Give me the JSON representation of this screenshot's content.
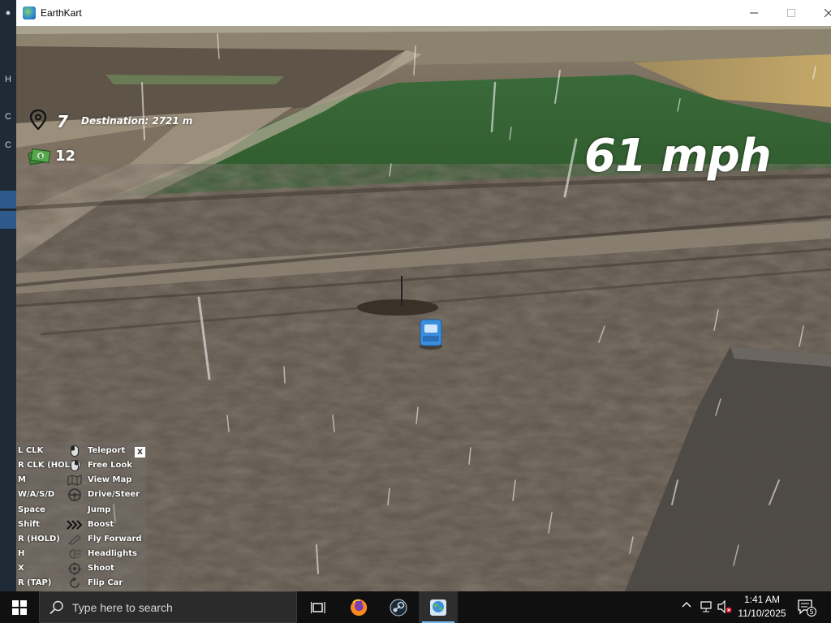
{
  "window": {
    "title": "EarthKart",
    "minimize": "—",
    "maximize": "☐",
    "close": "✕"
  },
  "hud": {
    "pin_count": "7",
    "destination": "Destination: 2721 m",
    "cash_count": "12",
    "speed": "61 mph"
  },
  "controls": {
    "close_label": "X",
    "rows": [
      {
        "key": "L CLK",
        "icon": "mouse-left-icon",
        "action": "Teleport"
      },
      {
        "key": "R CLK (HOLD)",
        "icon": "mouse-right-icon",
        "action": "Free Look"
      },
      {
        "key": "M",
        "icon": "map-icon",
        "action": "View Map"
      },
      {
        "key": "W/A/S/D",
        "icon": "steering-wheel-icon",
        "action": "Drive/Steer"
      },
      {
        "key": "Space",
        "icon": "jump-icon",
        "action": "Jump"
      },
      {
        "key": "Shift",
        "icon": "boost-icon",
        "action": "Boost"
      },
      {
        "key": "R (HOLD)",
        "icon": "fly-icon",
        "action": "Fly Forward"
      },
      {
        "key": "H",
        "icon": "headlights-icon",
        "action": "Headlights"
      },
      {
        "key": "X",
        "icon": "crosshair-icon",
        "action": "Shoot"
      },
      {
        "key": "R (TAP)",
        "icon": "flip-icon",
        "action": "Flip Car"
      }
    ]
  },
  "taskbar": {
    "search_placeholder": "Type here to search",
    "time": "1:41 AM",
    "date": "11/10/2025",
    "notification_count": "5",
    "apps": [
      "task-view-icon",
      "firefox-icon",
      "steam-icon",
      "earthkart-icon"
    ]
  },
  "desk_strip": [
    "H",
    "C",
    "C"
  ]
}
